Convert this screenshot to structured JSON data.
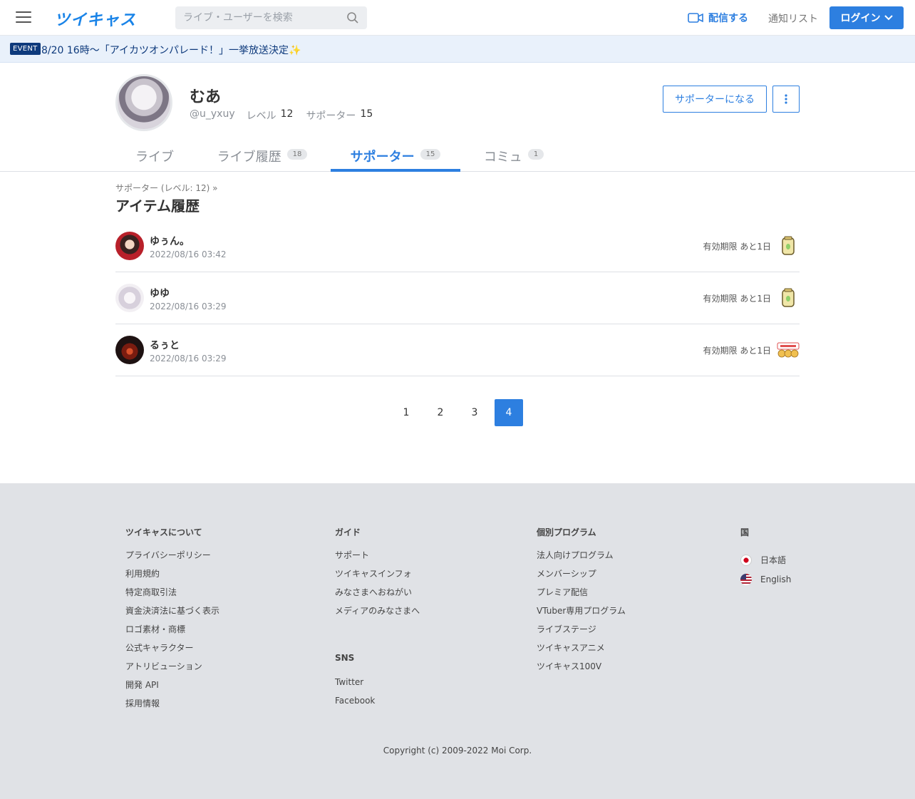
{
  "header": {
    "logo": "ツイキャス",
    "search_placeholder": "ライブ・ユーザーを検索",
    "broadcast": "配信する",
    "notify": "通知リスト",
    "login": "ログイン"
  },
  "event": {
    "badge": "EVENT",
    "text": "8/20 16時〜「アイカツオンパレード！」一挙放送決定✨"
  },
  "profile": {
    "name": "むあ",
    "handle": "@u_yxuy",
    "level_label": "レベル",
    "level": "12",
    "supporter_label": "サポーター",
    "supporter_count": "15",
    "support_button": "サポーターになる"
  },
  "tabs": [
    {
      "label": "ライブ",
      "count": ""
    },
    {
      "label": "ライブ履歴",
      "count": "18"
    },
    {
      "label": "サポーター",
      "count": "15"
    },
    {
      "label": "コミュ",
      "count": "1"
    }
  ],
  "breadcrumb": "サポーター (レベル: 12)  »",
  "page_title": "アイテム履歴",
  "items": [
    {
      "name": "ゆぅん。",
      "date": "2022/08/16 03:42",
      "expire": "有効期限 あと1日"
    },
    {
      "name": "ゆゆ",
      "date": "2022/08/16 03:29",
      "expire": "有効期限 あと1日"
    },
    {
      "name": "るぅと",
      "date": "2022/08/16 03:29",
      "expire": "有効期限 あと1日"
    }
  ],
  "pagination": [
    "1",
    "2",
    "3",
    "4"
  ],
  "footer": {
    "col1": {
      "heading": "ツイキャスについて",
      "links": [
        "プライバシーポリシー",
        "利用規約",
        "特定商取引法",
        "資金決済法に基づく表示",
        "ロゴ素材・商標",
        "公式キャラクター",
        "アトリビューション",
        "開発 API",
        "採用情報"
      ]
    },
    "col2": {
      "heading": "ガイド",
      "links": [
        "サポート",
        "ツイキャスインフォ",
        "みなさまへおねがい",
        "メディアのみなさまへ"
      ]
    },
    "col2b": {
      "heading": "SNS",
      "links": [
        "Twitter",
        "Facebook"
      ]
    },
    "col3": {
      "heading": "個別プログラム",
      "links": [
        "法人向けプログラム",
        "メンバーシップ",
        "プレミア配信",
        "VTuber専用プログラム",
        "ライブステージ",
        "ツイキャスアニメ",
        "ツイキャス100V"
      ]
    },
    "col4": {
      "heading": "国",
      "links": [
        "日本語",
        "English"
      ]
    },
    "copyright": "Copyright (c) 2009-2022 Moi Corp."
  },
  "colors": {
    "accent": "#2d7fe0",
    "event_bg": "#e9f1fb",
    "footer_bg": "#e0e2e6"
  }
}
